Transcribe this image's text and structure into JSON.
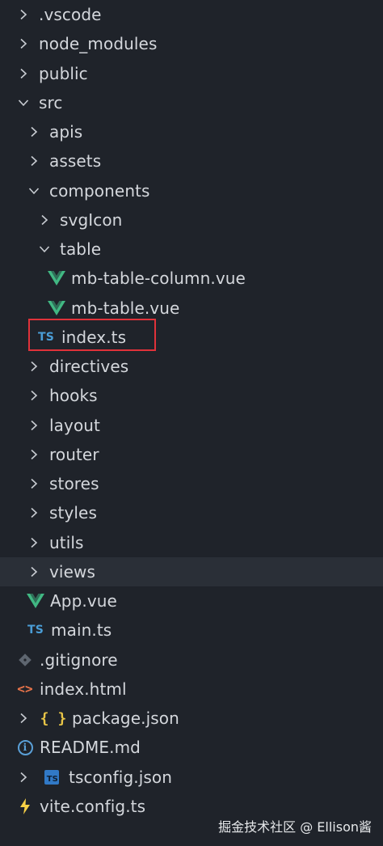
{
  "explorer": {
    "items": [
      {
        "label": ".vscode",
        "depth": 0,
        "kind": "folder",
        "expanded": false,
        "icon": "chevron-right-icon"
      },
      {
        "label": "node_modules",
        "depth": 0,
        "kind": "folder",
        "expanded": false,
        "icon": "chevron-right-icon"
      },
      {
        "label": "public",
        "depth": 0,
        "kind": "folder",
        "expanded": false,
        "icon": "chevron-right-icon"
      },
      {
        "label": "src",
        "depth": 0,
        "kind": "folder",
        "expanded": true,
        "icon": "chevron-down-icon"
      },
      {
        "label": "apis",
        "depth": 1,
        "kind": "folder",
        "expanded": false,
        "icon": "chevron-right-icon"
      },
      {
        "label": "assets",
        "depth": 1,
        "kind": "folder",
        "expanded": false,
        "icon": "chevron-right-icon"
      },
      {
        "label": "components",
        "depth": 1,
        "kind": "folder",
        "expanded": true,
        "icon": "chevron-down-icon"
      },
      {
        "label": "svgIcon",
        "depth": 2,
        "kind": "folder",
        "expanded": false,
        "icon": "chevron-right-icon"
      },
      {
        "label": "table",
        "depth": 2,
        "kind": "folder",
        "expanded": true,
        "icon": "chevron-down-icon"
      },
      {
        "label": "mb-table-column.vue",
        "depth": 3,
        "kind": "file",
        "icon": "vue-icon"
      },
      {
        "label": "mb-table.vue",
        "depth": 3,
        "kind": "file",
        "icon": "vue-icon"
      },
      {
        "label": "index.ts",
        "depth": 2,
        "kind": "file",
        "icon": "typescript-icon",
        "highlighted": true
      },
      {
        "label": "directives",
        "depth": 1,
        "kind": "folder",
        "expanded": false,
        "icon": "chevron-right-icon"
      },
      {
        "label": "hooks",
        "depth": 1,
        "kind": "folder",
        "expanded": false,
        "icon": "chevron-right-icon"
      },
      {
        "label": "layout",
        "depth": 1,
        "kind": "folder",
        "expanded": false,
        "icon": "chevron-right-icon"
      },
      {
        "label": "router",
        "depth": 1,
        "kind": "folder",
        "expanded": false,
        "icon": "chevron-right-icon"
      },
      {
        "label": "stores",
        "depth": 1,
        "kind": "folder",
        "expanded": false,
        "icon": "chevron-right-icon"
      },
      {
        "label": "styles",
        "depth": 1,
        "kind": "folder",
        "expanded": false,
        "icon": "chevron-right-icon"
      },
      {
        "label": "utils",
        "depth": 1,
        "kind": "folder",
        "expanded": false,
        "icon": "chevron-right-icon"
      },
      {
        "label": "views",
        "depth": 1,
        "kind": "folder",
        "expanded": false,
        "icon": "chevron-right-icon",
        "selected": true
      },
      {
        "label": "App.vue",
        "depth": 1,
        "kind": "file",
        "icon": "vue-icon"
      },
      {
        "label": "main.ts",
        "depth": 1,
        "kind": "file",
        "icon": "typescript-icon"
      },
      {
        "label": ".gitignore",
        "depth": 0,
        "kind": "file",
        "icon": "git-icon"
      },
      {
        "label": "index.html",
        "depth": 0,
        "kind": "file",
        "icon": "html-icon"
      },
      {
        "label": "package.json",
        "depth": 0,
        "kind": "nested",
        "icon": "json-icon"
      },
      {
        "label": "README.md",
        "depth": 0,
        "kind": "file",
        "icon": "info-icon"
      },
      {
        "label": "tsconfig.json",
        "depth": 0,
        "kind": "nested",
        "icon": "tsconfig-icon"
      },
      {
        "label": "vite.config.ts",
        "depth": 0,
        "kind": "file",
        "icon": "vite-icon"
      }
    ]
  },
  "colors": {
    "background": "#1f232a",
    "selected_row": "#2a2f37",
    "highlight_border": "#e0323a",
    "vue_green": "#41b883",
    "ts_blue": "#4a9dd6"
  },
  "watermark": "掘金技术社区 @ Ellison酱"
}
